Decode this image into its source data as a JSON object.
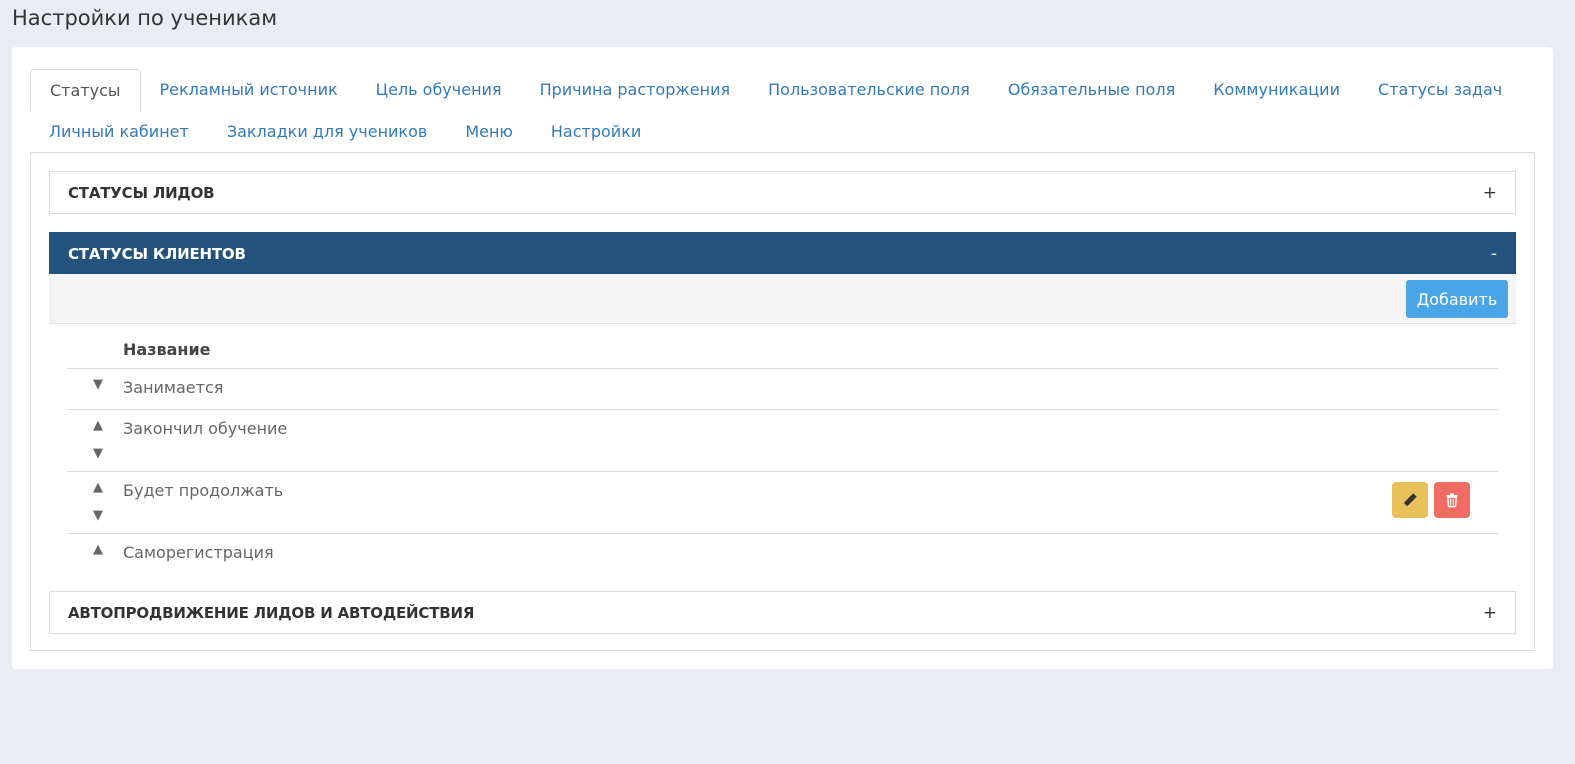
{
  "page": {
    "title": "Настройки по ученикам"
  },
  "tabs": {
    "row1": [
      "Статусы",
      "Рекламный источник",
      "Цель обучения",
      "Причина расторжения",
      "Пользовательские поля",
      "Обязательные поля",
      "Коммуникации",
      "Статусы задач"
    ],
    "row2": [
      "Личный кабинет",
      "Закладки для учеников",
      "Меню",
      "Настройки"
    ],
    "active": "Статусы"
  },
  "sections": {
    "leads": {
      "title": "Статусы лидов",
      "toggle": "+"
    },
    "clients": {
      "title": "Статусы клиентов",
      "toggle": "-"
    },
    "auto": {
      "title": "Автопродвижение лидов и автодействия",
      "toggle": "+"
    }
  },
  "toolbar": {
    "add_label": "Добавить"
  },
  "table": {
    "header": "Название",
    "rows": [
      "Занимается",
      "Закончил обучение",
      "Будет продолжать",
      "Саморегистрация"
    ]
  },
  "icons": {
    "up": "triangle-up-icon",
    "down": "triangle-down-icon",
    "edit": "pencil-icon",
    "delete": "trash-icon"
  },
  "colors": {
    "accent": "#23527c",
    "add_button": "#4aa5e6",
    "edit_button": "#e8c15b",
    "delete_button": "#f06b62",
    "link": "#337ab7"
  }
}
